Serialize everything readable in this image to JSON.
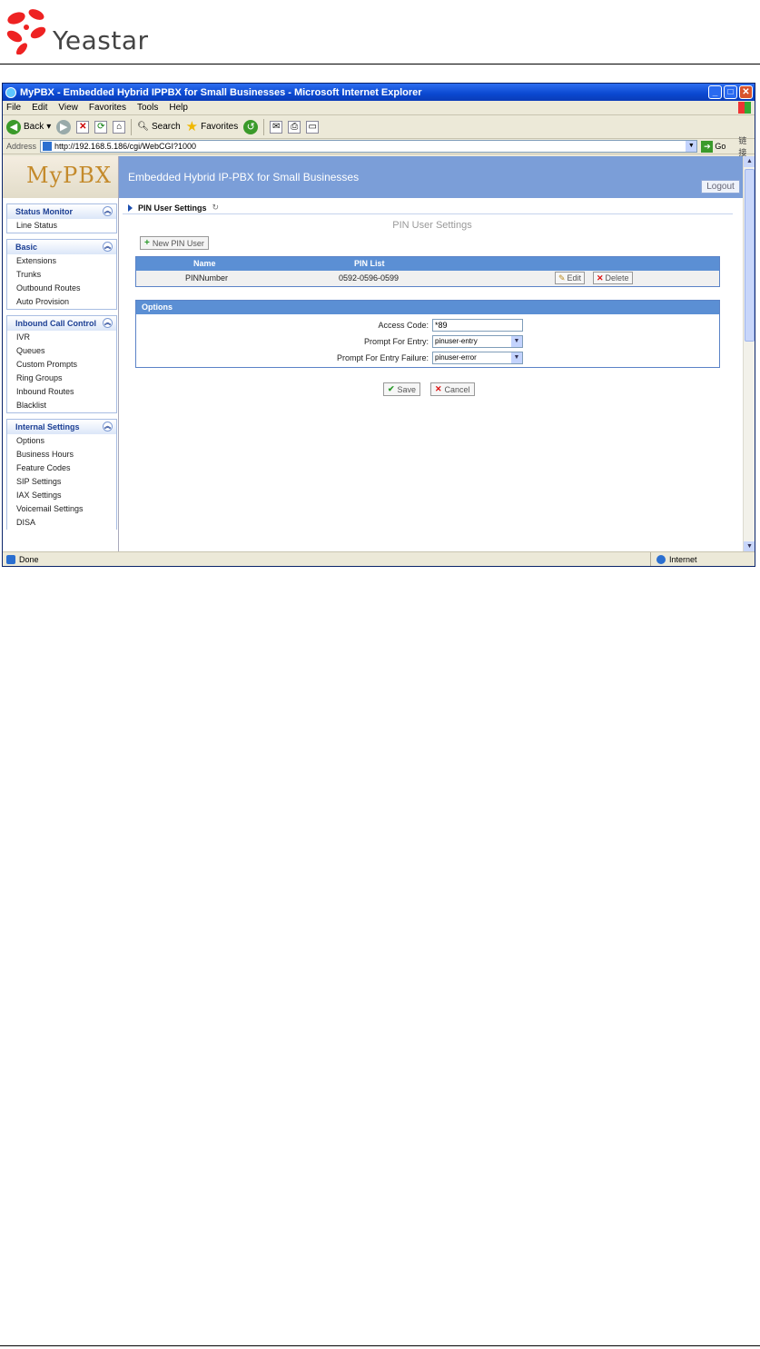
{
  "doc": {
    "brand": "Yeastar"
  },
  "window": {
    "title": "MyPBX - Embedded Hybrid IPPBX for Small Businesses - Microsoft Internet Explorer",
    "menu": [
      "File",
      "Edit",
      "View",
      "Favorites",
      "Tools",
      "Help"
    ],
    "toolbar": {
      "back": "Back",
      "search": "Search",
      "favorites": "Favorites"
    },
    "address_label": "Address",
    "address_url": "http://192.168.5.186/cgi/WebCGI?1000",
    "go_label": "Go",
    "links_label": "链接",
    "status_text": "Done",
    "zone_text": "Internet"
  },
  "app": {
    "logo": "MyPBX",
    "banner_title": "Embedded Hybrid IP-PBX for Small Businesses",
    "logout": "Logout"
  },
  "sidebar": {
    "sections": [
      {
        "title": "Status Monitor",
        "items": [
          "Line Status"
        ]
      },
      {
        "title": "Basic",
        "items": [
          "Extensions",
          "Trunks",
          "Outbound Routes",
          "Auto Provision"
        ]
      },
      {
        "title": "Inbound Call Control",
        "items": [
          "IVR",
          "Queues",
          "Custom Prompts",
          "Ring Groups",
          "Inbound Routes",
          "Blacklist"
        ]
      },
      {
        "title": "Internal Settings",
        "items": [
          "Options",
          "Business Hours",
          "Feature Codes",
          "SIP Settings",
          "IAX Settings",
          "Voicemail Settings",
          "DISA"
        ]
      }
    ]
  },
  "main": {
    "breadcrumb": "PIN User Settings",
    "page_title": "PIN User Settings",
    "new_button": "New PIN User",
    "table": {
      "headers": {
        "name": "Name",
        "pin_list": "PIN List"
      },
      "rows": [
        {
          "name": "PINNumber",
          "pin_list": "0592-0596-0599"
        }
      ],
      "edit": "Edit",
      "delete": "Delete"
    },
    "options": {
      "title": "Options",
      "access_code_label": "Access Code:",
      "access_code_value": "*89",
      "prompt_entry_label": "Prompt For Entry:",
      "prompt_entry_value": "pinuser-entry",
      "prompt_failure_label": "Prompt For Entry Failure:",
      "prompt_failure_value": "pinuser-error"
    },
    "save": "Save",
    "cancel": "Cancel"
  }
}
